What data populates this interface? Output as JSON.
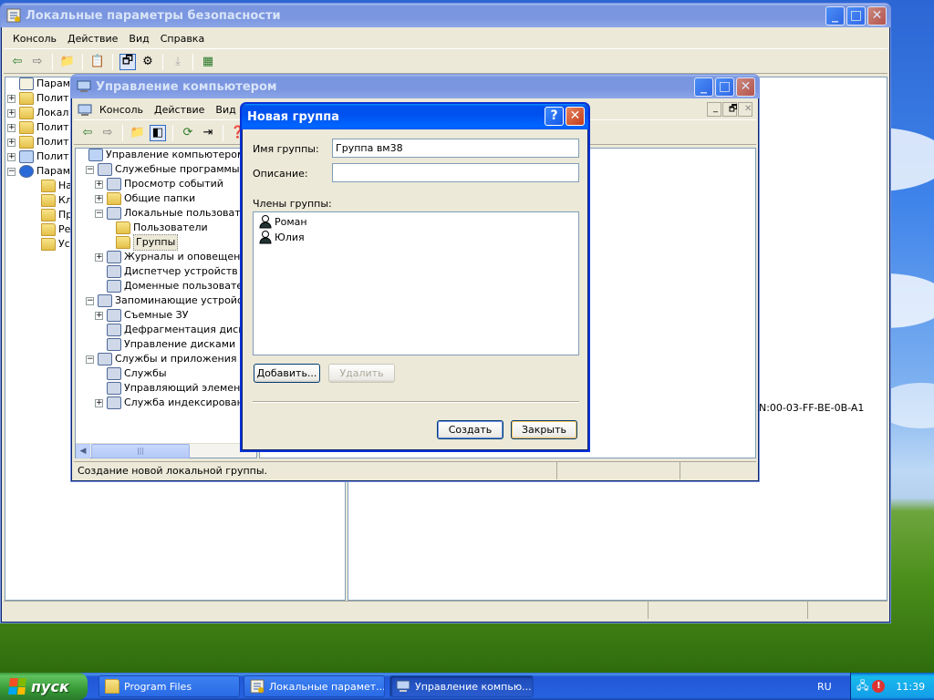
{
  "colors": {
    "accent": "#0054e3",
    "dialog_border": "#0831d9",
    "taskbar": "#245edb",
    "start_green": "#3c9a3c",
    "window_bg": "#ece9d8"
  },
  "lsp_window": {
    "title": "Локальные параметры безопасности",
    "menu": [
      "Консоль",
      "Действие",
      "Вид",
      "Справка"
    ],
    "tree": [
      {
        "label": "Параметр",
        "icon": "settings-icon",
        "expander": ""
      },
      {
        "label": "Полит",
        "icon": "folder-icon",
        "expander": "+"
      },
      {
        "label": "Локал",
        "icon": "folder-icon",
        "expander": "+"
      },
      {
        "label": "Полит",
        "icon": "folder-icon",
        "expander": "+"
      },
      {
        "label": "Полит",
        "icon": "folder-icon",
        "expander": "+"
      },
      {
        "label": "Полит",
        "icon": "computer-icon",
        "expander": "+"
      },
      {
        "label": "Парам",
        "icon": "security-icon",
        "expander": "−"
      },
      {
        "label": "На",
        "icon": "folder-icon",
        "expander": ""
      },
      {
        "label": "Кл",
        "icon": "folder-icon",
        "expander": ""
      },
      {
        "label": "Пр",
        "icon": "folder-icon",
        "expander": ""
      },
      {
        "label": "Ре",
        "icon": "folder-icon",
        "expander": ""
      },
      {
        "label": "Ус",
        "icon": "folder-icon",
        "expander": ""
      }
    ],
    "right_text": "N:00-03-FF-BE-0B-A1"
  },
  "cm_window": {
    "title": "Управление компьютером",
    "menu": [
      "Консоль",
      "Действие",
      "Вид"
    ],
    "tree": [
      {
        "label": "Управление компьютером (лока",
        "icon": "computer-icon",
        "expander": "",
        "level": 0
      },
      {
        "label": "Служебные программы",
        "icon": "tools-icon",
        "expander": "−",
        "level": 1
      },
      {
        "label": "Просмотр событий",
        "icon": "event-viewer-icon",
        "expander": "+",
        "level": 2
      },
      {
        "label": "Общие папки",
        "icon": "folder-icon",
        "expander": "+",
        "level": 2
      },
      {
        "label": "Локальные пользовател",
        "icon": "users-icon",
        "expander": "−",
        "level": 2
      },
      {
        "label": "Пользователи",
        "icon": "folder-icon",
        "expander": "",
        "level": 3
      },
      {
        "label": "Группы",
        "icon": "folder-icon",
        "expander": "",
        "level": 3
      },
      {
        "label": "Журналы и оповещения",
        "icon": "logs-icon",
        "expander": "+",
        "level": 2
      },
      {
        "label": "Диспетчер устройств",
        "icon": "device-manager-icon",
        "expander": "",
        "level": 2
      },
      {
        "label": "Доменные пользовател",
        "icon": "domain-users-icon",
        "expander": "",
        "level": 2
      },
      {
        "label": "Запоминающие устройства",
        "icon": "storage-icon",
        "expander": "−",
        "level": 1
      },
      {
        "label": "Съемные ЗУ",
        "icon": "removable-storage-icon",
        "expander": "+",
        "level": 2
      },
      {
        "label": "Дефрагментация диска",
        "icon": "defrag-icon",
        "expander": "",
        "level": 2
      },
      {
        "label": "Управление дисками",
        "icon": "disk-management-icon",
        "expander": "",
        "level": 2
      },
      {
        "label": "Службы и приложения",
        "icon": "services-apps-icon",
        "expander": "−",
        "level": 1
      },
      {
        "label": "Службы",
        "icon": "services-icon",
        "expander": "",
        "level": 2
      },
      {
        "label": "Управляющий элемент W",
        "icon": "wmi-icon",
        "expander": "",
        "level": 2
      },
      {
        "label": "Служба индексирования",
        "icon": "indexing-icon",
        "expander": "+",
        "level": 2
      }
    ],
    "status": "Создание новой локальной группы."
  },
  "dialog": {
    "title": "Новая группа",
    "help_glyph": "?",
    "group_name_label": "Имя группы:",
    "group_name_value": "Группа вм38",
    "description_label": "Описание:",
    "description_value": "",
    "members_label": "Члены группы:",
    "members": [
      "Роман",
      "Юлия"
    ],
    "add_label": "Добавить...",
    "remove_label": "Удалить",
    "create_label": "Создать",
    "close_label": "Закрыть"
  },
  "taskbar": {
    "start_label": "пуск",
    "tasks": [
      {
        "label": "Program Files",
        "icon": "folder-icon"
      },
      {
        "label": "Локальные парамет...",
        "icon": "security-settings-icon"
      },
      {
        "label": "Управление компью...",
        "icon": "computer-management-icon"
      }
    ],
    "language": "RU",
    "clock": "11:39"
  }
}
